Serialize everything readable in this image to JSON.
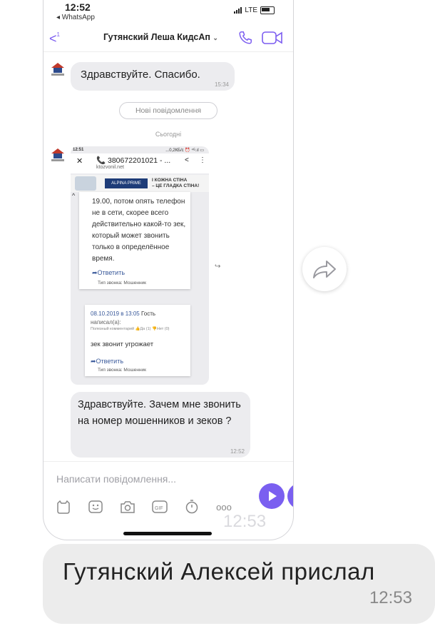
{
  "status_bar": {
    "time": "12:52",
    "back_app": "◂ WhatsApp",
    "network": "LTE"
  },
  "header": {
    "back_count": "1",
    "title": "Гутянский Леша КидсАп",
    "title_chevron": "⌄"
  },
  "messages": [
    {
      "text": "Здравствуйте. Спасибо.",
      "time": "15:34"
    }
  ],
  "new_messages_label": "Нові повідомлення",
  "today_label": "Сьогодні",
  "screenshot": {
    "status_time": "12:51",
    "status_right": "...0,2КБ/с ⏰ ⁴ᴳ.ıl ▭",
    "close": "✕",
    "phone_number": "380672201021 - ...",
    "site": "ktozvonil.net",
    "ad_logo": "ALPINA PRIME",
    "ad_line1": "І КОЖНА СТІНА",
    "ad_line2": "– ЦЕ ГЛАДКА СТІНА!",
    "card1_text": "19.00, потом опять телефон не в сети, скорее всего действительно какой-то зек, который может звонить только в определённое время.",
    "card1_reply": "Ответить",
    "card1_type": "Тип звонка: Мошенник",
    "card2_date": "08.10.2019 в 13:05",
    "card2_author": "Гость",
    "card2_wrote": "написал(а):",
    "card2_useful": "Полезный комментарий 👍Да (1)  👎Нет (0)",
    "card2_text": "зек звонит угрожает",
    "card2_reply": "Ответить",
    "card2_type": "Тип звонка: Мошенник"
  },
  "reply_message": {
    "text": "Здравствуйте. Зачем мне звонить на номер мошенников и зеков ?",
    "time": "12:52"
  },
  "composer": {
    "placeholder": "Написати повідомлення...",
    "overlay_time": "12:53"
  },
  "caption": {
    "text": "Гутянский Алексей прислал",
    "time": "12:53"
  }
}
